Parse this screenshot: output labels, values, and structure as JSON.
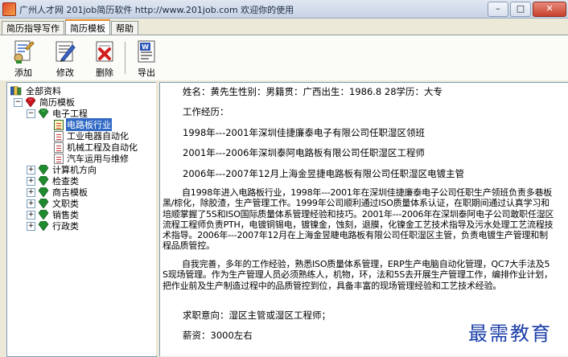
{
  "window": {
    "title": "广州人才网 201job简历软件 http://www.201job.com 欢迎你的使用",
    "min": "–",
    "max": "□",
    "close": "✕"
  },
  "tabs": [
    {
      "label": "简历指导写作"
    },
    {
      "label": "简历模板"
    },
    {
      "label": "帮助"
    }
  ],
  "toolbar": {
    "add": "添加",
    "edit": "修改",
    "delete": "删除",
    "export": "导出"
  },
  "tree": {
    "root": "全部资料",
    "template": "简历模板",
    "electronics": "电子工程",
    "pcb": "电路板行业",
    "industrial": "工业电器自动化",
    "mechanical": "机械工程及自动化",
    "auto": "汽车运用与维修",
    "computer": "计算机方向",
    "inspection": "检查类",
    "business": "商吉模板",
    "clerical": "文职类",
    "sales": "销售类",
    "admin": "行政类",
    "expand": "+",
    "collapse": "−"
  },
  "resume": {
    "header": "姓名：黄先生性别：男籍贯：广西出生：1986.8 28学历：大专",
    "exp_title": "工作经历：",
    "exp1": "1998年---2001年深圳佳捷廉泰电子有限公司任职湿区领班",
    "exp2": "2001年---2006年深圳泰阿电路板有限公司任职湿区工程师",
    "exp3": "2006年---2007年12月上海金昱捷电路板有限公司任职湿区电镀主管",
    "summary1": "自1998年进入电路板行业，1998年---2001年在深圳佳捷廉泰电子公司任职生产领班负责多巷板黑/棕化，除胶渣，生产管理工作。1999年公司顺利通过ISO质量体系认证，在职期间通过认真学习和培顺掌握了5S和ISO国际质量体系管理经验和技巧。2001年---2006年在深圳泰阿电子公司敢职任湿区流程工程师负责PTH，电镀铜锡电，镀镍金，蚀刻，退膜，化镍金工艺技术指导及污水处理工艺流程技术指导。2006年---2007年12月在上海金昱睫电路板有限公司任职湿区主管，负责电镀生产管理和制程品质管控。",
    "summary2": "自我完善，多年的工作经验，熟悉ISO质量体系管理，ERP生产电脑自动化管理，QC7大手法及5S现场管理。作为生产管理人员必须熟练人，机物，环，法和5S去开展生产管理工作，编排作业计划，把作业前及生产制造过程中的品质管控到位，具备丰富的现场管理经验和工艺技术经验。",
    "intention": "求职意向：湿区主管或湿区工程师；",
    "salary": "薪资：3000左右"
  },
  "watermark": "最需教育",
  "colors": {
    "selection": "#316ac5",
    "watermark": "#1c3fa8",
    "tab_accent": "#e68b2c"
  }
}
